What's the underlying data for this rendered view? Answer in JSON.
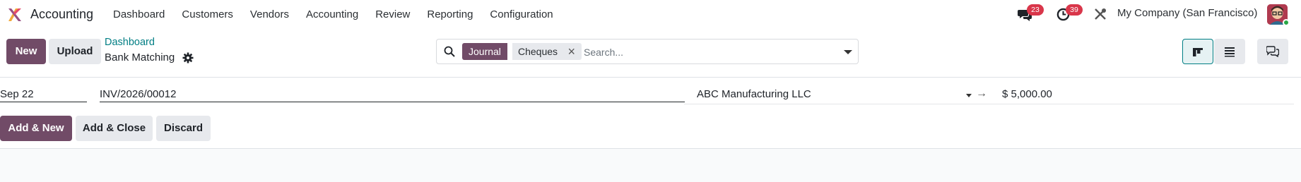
{
  "app": {
    "name": "Accounting",
    "colors": {
      "brand": "#714b67",
      "link": "#017e84",
      "badge": "#d9364a"
    }
  },
  "menu": {
    "items": [
      "Dashboard",
      "Customers",
      "Vendors",
      "Accounting",
      "Review",
      "Reporting",
      "Configuration"
    ]
  },
  "systray": {
    "messages_badge": "23",
    "activities_badge": "39",
    "company": "My Company (San Francisco)"
  },
  "control_panel": {
    "new_label": "New",
    "upload_label": "Upload",
    "breadcrumb": "Dashboard",
    "title": "Bank Matching"
  },
  "search": {
    "facet_label": "Journal",
    "facet_value": "Cheques",
    "placeholder": "Search...",
    "value": ""
  },
  "line": {
    "date": "Sep 22",
    "label": "INV/2026/00012",
    "partner": "ABC Manufacturing LLC",
    "amount": "$ 5,000.00"
  },
  "actions": {
    "add_new_label": "Add & New",
    "add_close_label": "Add & Close",
    "discard_label": "Discard"
  }
}
